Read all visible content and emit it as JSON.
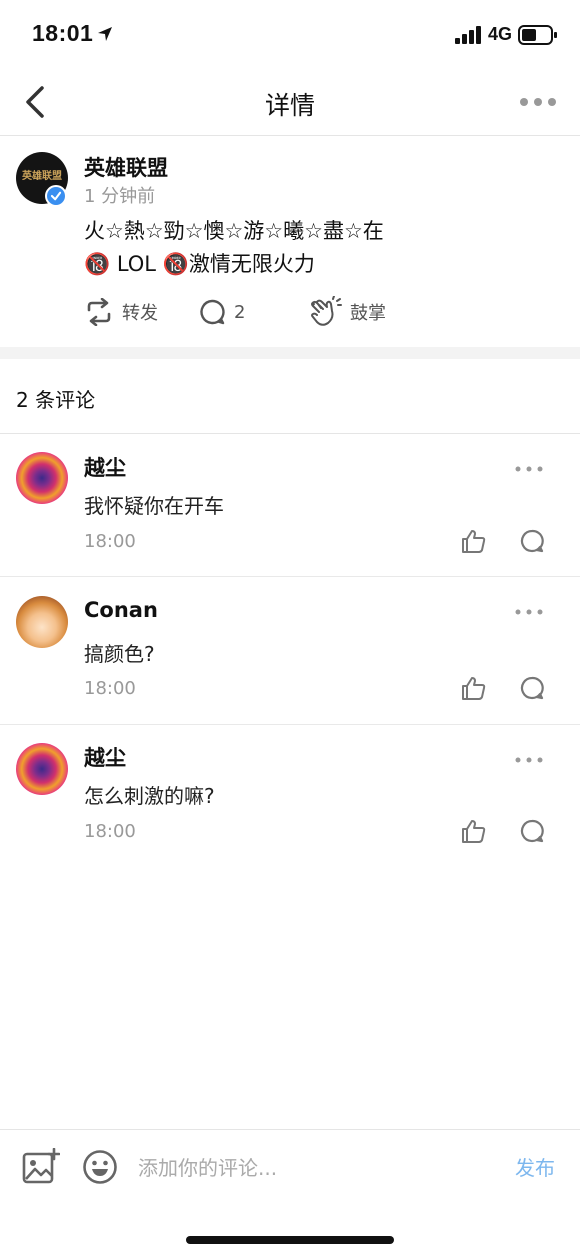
{
  "status_bar": {
    "time": "18:01",
    "network": "4G"
  },
  "nav": {
    "title": "详情"
  },
  "post": {
    "author": "英雄联盟",
    "avatar_text": "英雄联盟",
    "time": "1 分钟前",
    "line1": "火☆熱☆勁☆懊☆游☆曦☆盡☆在",
    "line2": "🔞 LOL 🔞激情无限火力",
    "repost_label": "转发",
    "comment_count": "2",
    "clap_label": "鼓掌"
  },
  "comments_header": "2 条评论",
  "comments": [
    {
      "name": "越尘",
      "text": "我怀疑你在开车",
      "time": "18:00"
    },
    {
      "name": "Conan",
      "text": "搞颜色?",
      "time": "18:00"
    },
    {
      "name": "越尘",
      "text": "怎么刺激的嘛?",
      "time": "18:00"
    }
  ],
  "composer": {
    "placeholder": "添加你的评论...",
    "send_label": "发布"
  },
  "colors": {
    "accent": "#7db7ee",
    "verify": "#3a8ff0"
  }
}
